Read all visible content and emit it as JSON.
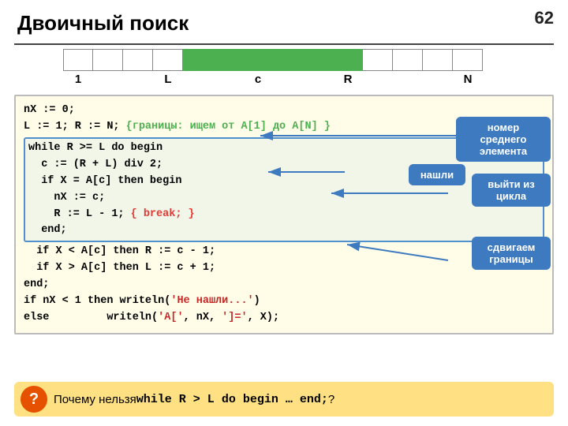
{
  "page": {
    "number": "62",
    "title": "Двоичный поиск"
  },
  "array": {
    "total_cells": 14,
    "green_start": 4,
    "green_end": 9,
    "labels": [
      {
        "text": "1",
        "offset": 0
      },
      {
        "text": "L",
        "offset": 3
      },
      {
        "text": "c",
        "offset": 6
      },
      {
        "text": "R",
        "offset": 9
      },
      {
        "text": "N",
        "offset": 13
      }
    ]
  },
  "code": {
    "lines": [
      {
        "id": "l1",
        "text": "nX := 0;"
      },
      {
        "id": "l2",
        "text": "L := 1; R := N; "
      },
      {
        "id": "l2c",
        "text": "{границы: ищем от A[1] до A[N] }"
      },
      {
        "id": "l3",
        "text": "while R >= L do begin"
      },
      {
        "id": "l4",
        "text": "  c := (R + L) div 2;"
      },
      {
        "id": "l5",
        "text": "  if X = A[c] then begin"
      },
      {
        "id": "l6",
        "text": "    nX := c;"
      },
      {
        "id": "l7a",
        "text": "    R := L - 1; "
      },
      {
        "id": "l7b",
        "text": "{ break; }"
      },
      {
        "id": "l8",
        "text": "  end;"
      },
      {
        "id": "l9",
        "text": "  if X < A[c] then R := c - 1;"
      },
      {
        "id": "l10",
        "text": "  if X > A[c] then L := c + 1;"
      },
      {
        "id": "l11",
        "text": "end;"
      },
      {
        "id": "l12",
        "text": "if nX < 1 then writeln('Не нашли...')"
      },
      {
        "id": "l13a",
        "text": "else         "
      },
      {
        "id": "l13b",
        "text": "writeln('A[', nX, ']=', X);"
      }
    ]
  },
  "callouts": {
    "middle": "номер среднего\nэлемента",
    "found": "нашли",
    "exit": "выйти из\nцикла",
    "shift": "сдвигаем\nграницы"
  },
  "question": {
    "text": "Почему нельзя ",
    "code": "while R > L do begin … end;",
    "suffix": "?"
  }
}
